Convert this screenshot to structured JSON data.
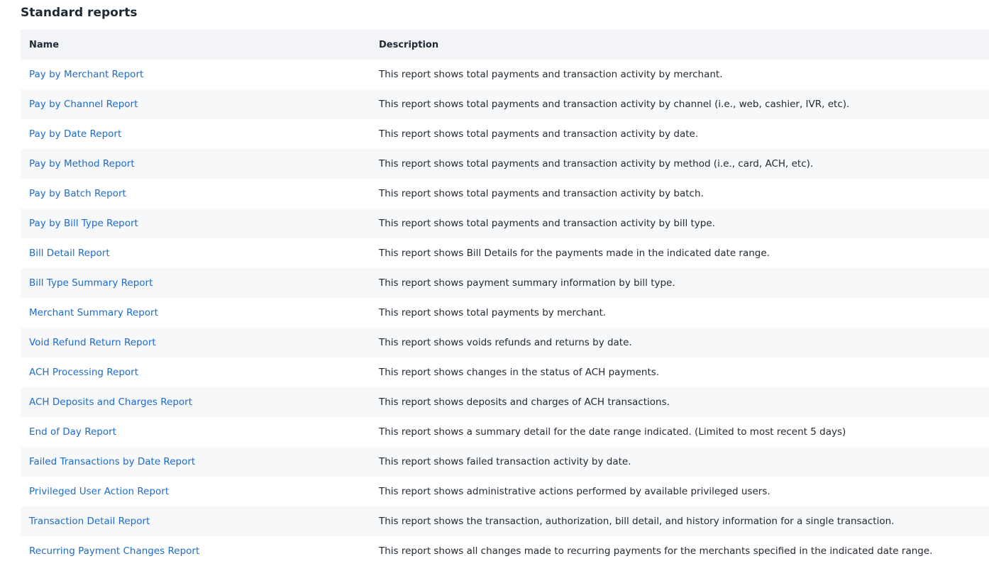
{
  "page": {
    "title": "Standard reports"
  },
  "table": {
    "headers": {
      "name": "Name",
      "description": "Description"
    },
    "rows": [
      {
        "name": "Pay by Merchant Report",
        "description": "This report shows total payments and transaction activity by merchant."
      },
      {
        "name": "Pay by Channel Report",
        "description": "This report shows total payments and transaction activity by channel (i.e., web, cashier, IVR, etc)."
      },
      {
        "name": "Pay by Date Report",
        "description": "This report shows total payments and transaction activity by date."
      },
      {
        "name": "Pay by Method Report",
        "description": "This report shows total payments and transaction activity by method (i.e., card, ACH, etc)."
      },
      {
        "name": "Pay by Batch Report",
        "description": "This report shows total payments and transaction activity by batch."
      },
      {
        "name": "Pay by Bill Type Report",
        "description": "This report shows total payments and transaction activity by bill type."
      },
      {
        "name": "Bill Detail Report",
        "description": "This report shows Bill Details for the payments made in the indicated date range."
      },
      {
        "name": "Bill Type Summary Report",
        "description": "This report shows payment summary information by bill type."
      },
      {
        "name": "Merchant Summary Report",
        "description": "This report shows total payments by merchant."
      },
      {
        "name": "Void Refund Return Report",
        "description": "This report shows voids refunds and returns by date."
      },
      {
        "name": "ACH Processing Report",
        "description": "This report shows changes in the status of ACH payments."
      },
      {
        "name": "ACH Deposits and Charges Report",
        "description": "This report shows deposits and charges of ACH transactions."
      },
      {
        "name": "End of Day Report",
        "description": "This report shows a summary detail for the date range indicated. (Limited to most recent 5 days)"
      },
      {
        "name": "Failed Transactions by Date Report",
        "description": "This report shows failed transaction activity by date."
      },
      {
        "name": "Privileged User Action Report",
        "description": "This report shows administrative actions performed by available privileged users."
      },
      {
        "name": "Transaction Detail Report",
        "description": "This report shows the transaction, authorization, bill detail, and history information for a single transaction."
      },
      {
        "name": "Recurring Payment Changes Report",
        "description": "This report shows all changes made to recurring payments for the merchants specified in the indicated date range."
      }
    ]
  },
  "colors": {
    "link": "#1f6bc9",
    "header_bg": "#f2f4f7",
    "stripe_bg": "#f7f8f9",
    "text": "#222a33"
  }
}
